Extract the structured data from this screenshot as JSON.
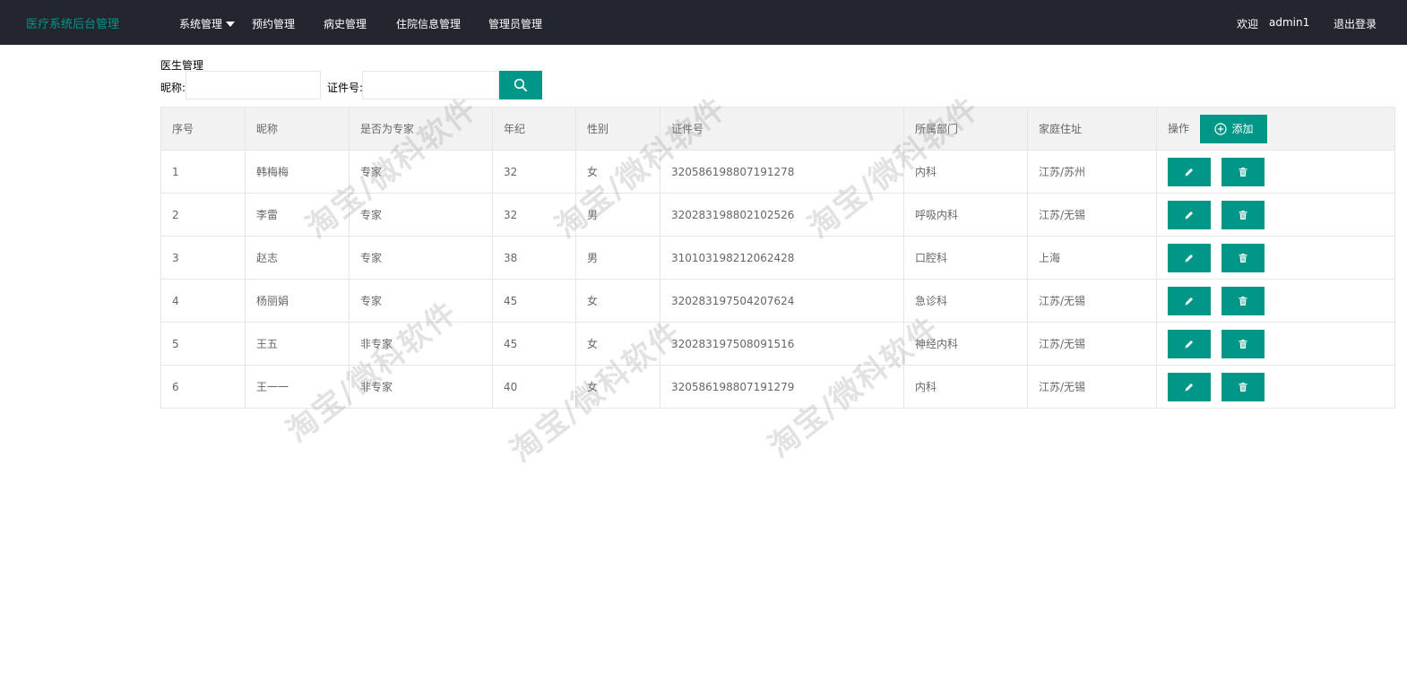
{
  "app": {
    "title": "医疗系统后台管理"
  },
  "nav": {
    "items": [
      "系统管理",
      "预约管理",
      "病史管理",
      "住院信息管理",
      "管理员管理"
    ]
  },
  "user": {
    "welcome": "欢迎",
    "name": "admin1",
    "logout": "退出登录"
  },
  "page": {
    "title": "医生管理"
  },
  "search": {
    "nickname_label": "昵称:",
    "nickname_value": "",
    "id_label": "证件号:",
    "id_value": ""
  },
  "table": {
    "headers": [
      "序号",
      "昵称",
      "是否为专家",
      "年纪",
      "性别",
      "证件号",
      "所属部门",
      "家庭住址",
      "操作"
    ],
    "add_label": "添加",
    "rows": [
      [
        "1",
        "韩梅梅",
        "专家",
        "32",
        "女",
        "320586198807191278",
        "内科",
        "江苏/苏州"
      ],
      [
        "2",
        "李雷",
        "专家",
        "32",
        "男",
        "320283198802102526",
        "呼吸内科",
        "江苏/无锡"
      ],
      [
        "3",
        "赵志",
        "专家",
        "38",
        "男",
        "310103198212062428",
        "口腔科",
        "上海"
      ],
      [
        "4",
        "杨丽娟",
        "专家",
        "45",
        "女",
        "320283197504207624",
        "急诊科",
        "江苏/无锡"
      ],
      [
        "5",
        "王五",
        "非专家",
        "45",
        "女",
        "320283197508091516",
        "神经内科",
        "江苏/无锡"
      ],
      [
        "6",
        "王一一",
        "非专家",
        "40",
        "女",
        "320586198807191279",
        "内科",
        "江苏/无锡"
      ]
    ]
  },
  "watermark": {
    "text": "淘宝/微科软件"
  },
  "icons": {
    "search": "search-icon",
    "add": "plus-circle-icon",
    "edit": "pencil-icon",
    "delete": "trash-icon"
  },
  "colors": {
    "accent": "#009688",
    "topbar": "#23262e"
  }
}
